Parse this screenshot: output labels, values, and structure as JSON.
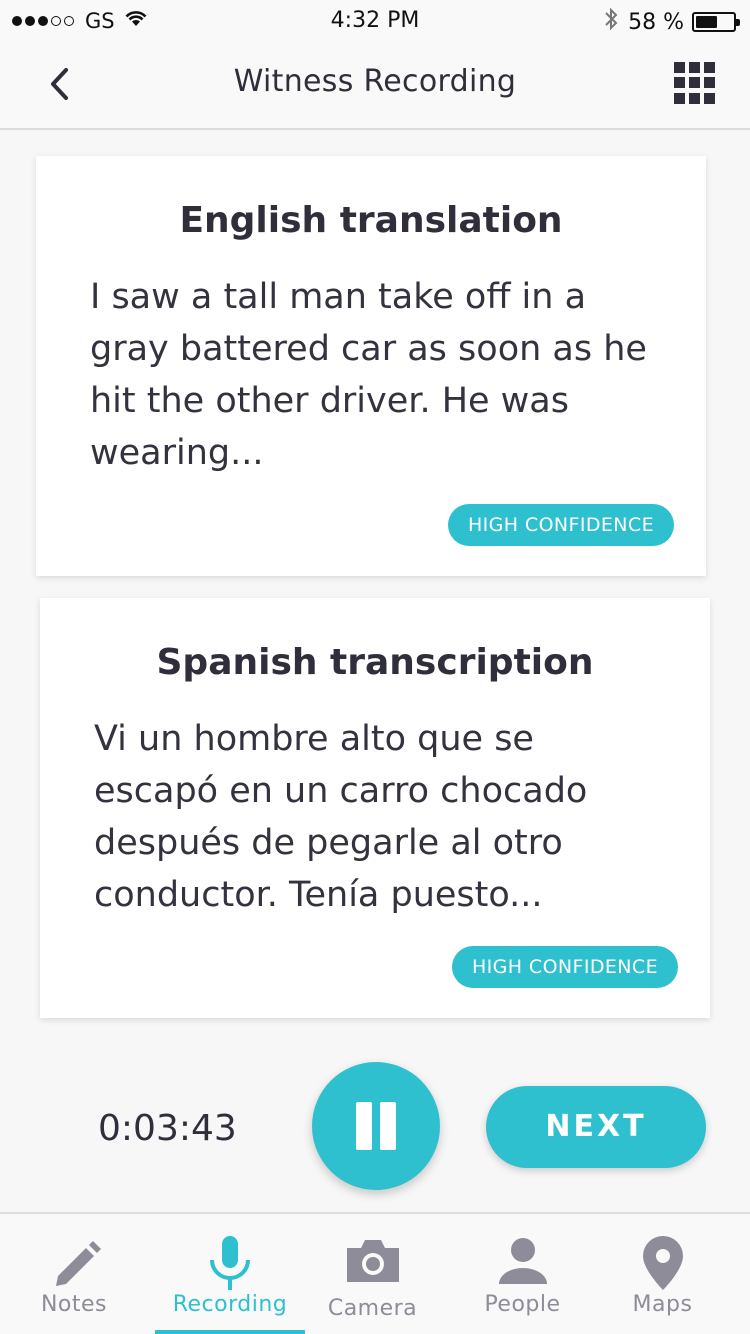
{
  "status_bar": {
    "carrier": "GS",
    "time": "4:32 PM",
    "battery": "58 %",
    "battery_level": 0.58
  },
  "nav": {
    "title": "Witness Recording"
  },
  "cards": [
    {
      "title": "English translation",
      "text": "I saw a tall man take off in a gray battered car as soon as he hit the other driver. He was wearing...",
      "badge": "HIGH CONFIDENCE"
    },
    {
      "title": "Spanish transcription",
      "text": "Vi un hombre alto que se escapó en un carro chocado después de pegarle al otro conductor. Tenía puesto...",
      "badge": "HIGH CONFIDENCE"
    }
  ],
  "controls": {
    "timer": "0:03:43",
    "next_label": "NEXT"
  },
  "tabs": [
    {
      "label": "Notes",
      "icon": "pencil-icon"
    },
    {
      "label": "Recording",
      "icon": "microphone-icon",
      "active": true
    },
    {
      "label": "Camera",
      "icon": "camera-icon"
    },
    {
      "label": "People",
      "icon": "person-icon"
    },
    {
      "label": "Maps",
      "icon": "map-pin-icon"
    }
  ],
  "colors": {
    "accent": "#2fc0cf",
    "inactive_tab": "#8e8c98",
    "text": "#2f2e3a"
  }
}
